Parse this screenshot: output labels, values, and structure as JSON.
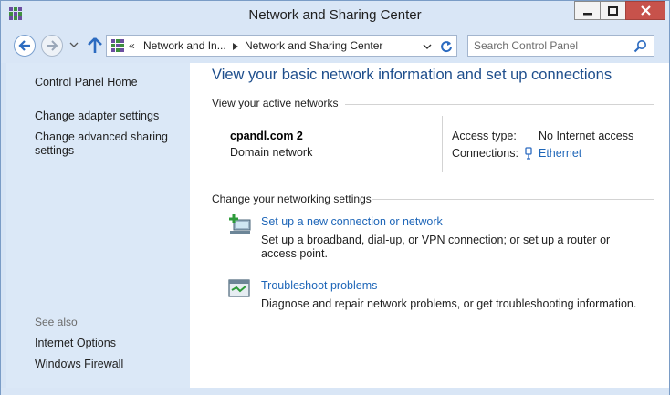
{
  "window": {
    "title": "Network and Sharing Center"
  },
  "navigation": {
    "address_prefix": "«",
    "breadcrumb": [
      "Network and In...",
      "Network and Sharing Center"
    ],
    "search_placeholder": "Search Control Panel"
  },
  "sidebar": {
    "links": [
      "Control Panel Home",
      "Change adapter settings",
      "Change advanced sharing settings"
    ],
    "see_also_heading": "See also",
    "see_also": [
      "Internet Options",
      "Windows Firewall"
    ]
  },
  "main": {
    "title": "View your basic network information and set up connections",
    "active_networks_heading": "View your active networks",
    "network": {
      "name": "cpandl.com  2",
      "type": "Domain network",
      "access_type_label": "Access type:",
      "access_type_value": "No Internet access",
      "connections_label": "Connections:",
      "connections_value": "Ethernet"
    },
    "settings_heading": "Change your networking settings",
    "tasks": [
      {
        "title": "Set up a new connection or network",
        "description": "Set up a broadband, dial-up, or VPN connection; or set up a router or access point."
      },
      {
        "title": "Troubleshoot problems",
        "description": "Diagnose and repair network problems, or get troubleshooting information."
      }
    ]
  },
  "colors": {
    "link": "#1e66b8",
    "title": "#1e4e8c",
    "sidebar_bg": "#dbe8f7",
    "close_button": "#c7524b"
  },
  "icons": [
    "network-center-icon",
    "minimize-icon",
    "maximize-icon",
    "close-icon",
    "back-arrow-icon",
    "forward-arrow-icon",
    "recent-pages-chevron-icon",
    "up-arrow-icon",
    "control-panel-icon",
    "chevron-right-icon",
    "dropdown-chevron-icon",
    "refresh-icon",
    "search-icon",
    "ethernet-icon",
    "new-connection-icon",
    "troubleshoot-icon"
  ]
}
